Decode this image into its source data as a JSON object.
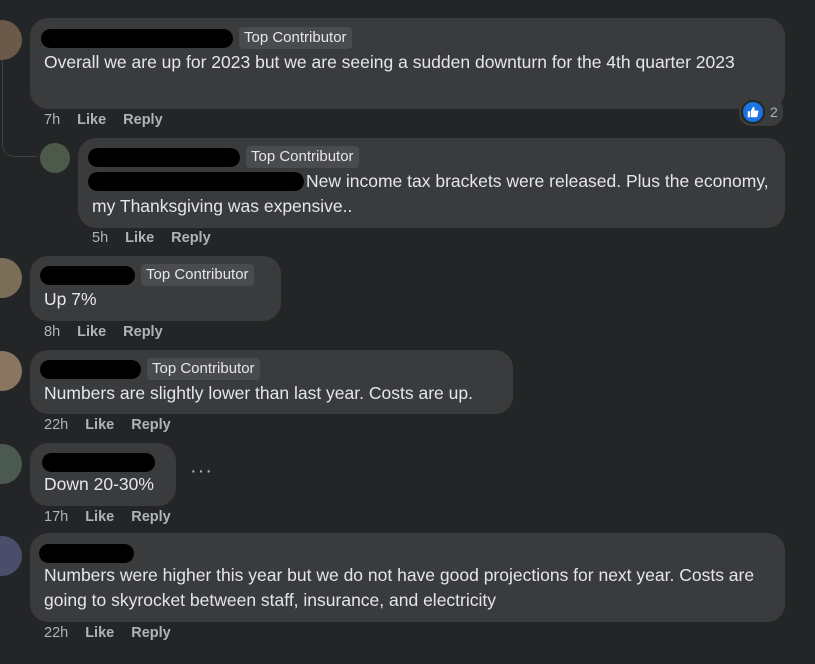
{
  "badges": {
    "top_contributor": "Top Contributor"
  },
  "actions": {
    "like": "Like",
    "reply": "Reply"
  },
  "comments": [
    {
      "text": "Overall we are up for 2023 but we are seeing a sudden downturn for the 4th quarter 2023",
      "time": "7h",
      "reactions": {
        "icon": "thumbs-up-icon",
        "count": "2"
      }
    },
    {
      "text": "New income tax brackets were released. Plus the economy, my Thanksgiving was expensive..",
      "time": "5h"
    },
    {
      "text": "Up 7%",
      "time": "8h"
    },
    {
      "text": "Numbers are slightly lower than last year. Costs are up.",
      "time": "22h"
    },
    {
      "text": "Down 20-30%",
      "time": "17h",
      "more": "···"
    },
    {
      "text": "Numbers were higher this year but we do not have good projections for next year. Costs are going to skyrocket between staff, insurance, and electricity",
      "time": "22h"
    }
  ],
  "colors": {
    "background": "#242526",
    "bubble": "#3a3b3c",
    "like_blue": "#1b74e4",
    "muted": "#b0b3b8"
  }
}
